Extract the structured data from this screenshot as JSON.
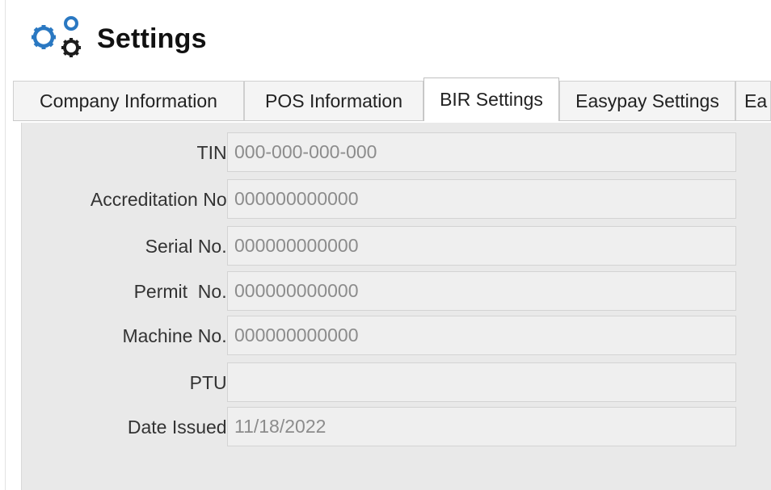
{
  "header": {
    "title": "Settings",
    "icon": "gears-icon"
  },
  "tabs": [
    {
      "label": "Company Information",
      "active": false
    },
    {
      "label": "POS Information",
      "active": false
    },
    {
      "label": "BIR Settings",
      "active": true
    },
    {
      "label": "Easypay Settings",
      "active": false
    },
    {
      "label": "Ea",
      "active": false
    }
  ],
  "bir_form": {
    "fields": [
      {
        "label": "TIN:",
        "value": "000-000-000-000"
      },
      {
        "label": "Accreditation No:",
        "value": "000000000000"
      },
      {
        "label": "Serial No.:",
        "value": "000000000000"
      },
      {
        "label": "Permit  No.:",
        "value": "000000000000"
      },
      {
        "label": "Machine No.:",
        "value": "000000000000"
      },
      {
        "label": "PTU:",
        "value": ""
      },
      {
        "label": "Date Issued:",
        "value": "11/18/2022"
      }
    ]
  },
  "colors": {
    "icon_blue": "#2a78c2",
    "panel_bg": "#e9e9e9",
    "field_bg": "#efefef",
    "field_text": "#8c8c8c"
  }
}
